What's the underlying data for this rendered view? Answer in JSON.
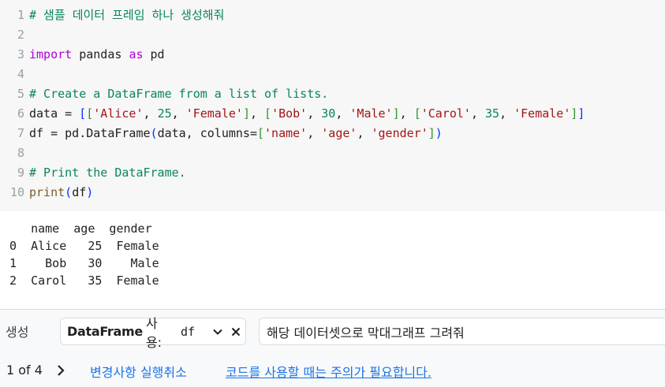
{
  "editor": {
    "line_numbers": [
      "1",
      "2",
      "3",
      "4",
      "5",
      "6",
      "7",
      "8",
      "9",
      "10"
    ],
    "lines": [
      [
        {
          "t": "comment",
          "v": "# 샘플 데이터 프레임 하나 생성해줘"
        }
      ],
      [],
      [
        {
          "t": "keyword",
          "v": "import"
        },
        {
          "t": "plain",
          "v": " pandas "
        },
        {
          "t": "keyword",
          "v": "as"
        },
        {
          "t": "plain",
          "v": " pd"
        }
      ],
      [],
      [
        {
          "t": "comment",
          "v": "# Create a DataFrame from a list of lists."
        }
      ],
      [
        {
          "t": "plain",
          "v": "data = "
        },
        {
          "t": "paren",
          "v": "["
        },
        {
          "t": "paren2",
          "v": "["
        },
        {
          "t": "string",
          "v": "'Alice'"
        },
        {
          "t": "plain",
          "v": ", "
        },
        {
          "t": "number",
          "v": "25"
        },
        {
          "t": "plain",
          "v": ", "
        },
        {
          "t": "string",
          "v": "'Female'"
        },
        {
          "t": "paren2",
          "v": "]"
        },
        {
          "t": "plain",
          "v": ", "
        },
        {
          "t": "paren2",
          "v": "["
        },
        {
          "t": "string",
          "v": "'Bob'"
        },
        {
          "t": "plain",
          "v": ", "
        },
        {
          "t": "number",
          "v": "30"
        },
        {
          "t": "plain",
          "v": ", "
        },
        {
          "t": "string",
          "v": "'Male'"
        },
        {
          "t": "paren2",
          "v": "]"
        },
        {
          "t": "plain",
          "v": ", "
        },
        {
          "t": "paren2",
          "v": "["
        },
        {
          "t": "string",
          "v": "'Carol'"
        },
        {
          "t": "plain",
          "v": ", "
        },
        {
          "t": "number",
          "v": "35"
        },
        {
          "t": "plain",
          "v": ", "
        },
        {
          "t": "string",
          "v": "'Female'"
        },
        {
          "t": "paren2",
          "v": "]"
        },
        {
          "t": "paren",
          "v": "]"
        }
      ],
      [
        {
          "t": "plain",
          "v": "df = pd.DataFrame"
        },
        {
          "t": "paren",
          "v": "("
        },
        {
          "t": "plain",
          "v": "data, columns="
        },
        {
          "t": "paren2",
          "v": "["
        },
        {
          "t": "string",
          "v": "'name'"
        },
        {
          "t": "plain",
          "v": ", "
        },
        {
          "t": "string",
          "v": "'age'"
        },
        {
          "t": "plain",
          "v": ", "
        },
        {
          "t": "string",
          "v": "'gender'"
        },
        {
          "t": "paren2",
          "v": "]"
        },
        {
          "t": "paren",
          "v": ")"
        }
      ],
      [],
      [
        {
          "t": "comment",
          "v": "# Print the DataFrame."
        }
      ],
      [
        {
          "t": "func",
          "v": "print"
        },
        {
          "t": "paren",
          "v": "("
        },
        {
          "t": "plain",
          "v": "df"
        },
        {
          "t": "paren",
          "v": ")"
        }
      ]
    ]
  },
  "output": {
    "lines": [
      "   name  age  gender",
      "0  Alice   25  Female",
      "1    Bob   30    Male",
      "2  Carol   35  Female"
    ]
  },
  "generate": {
    "label": "생성",
    "chip_title": "DataFrame",
    "chip_sub": "사용:",
    "chip_value": "df",
    "prompt_value": "해당 데이터셋으로 막대그래프 그려줘",
    "pager": "1 of 4",
    "undo_label": "변경사항 실행취소",
    "caution_label": "코드를 사용할 때는 주의가 필요합니다."
  },
  "icons": {
    "chip_dropdown": "chevron-down-icon",
    "chip_close": "close-icon",
    "pager_next": "chevron-right-icon"
  },
  "colors": {
    "link": "#1a73e8",
    "editor_bg": "#f7f7f7",
    "comment": "#098658",
    "keyword": "#af00db",
    "string": "#a31515"
  }
}
